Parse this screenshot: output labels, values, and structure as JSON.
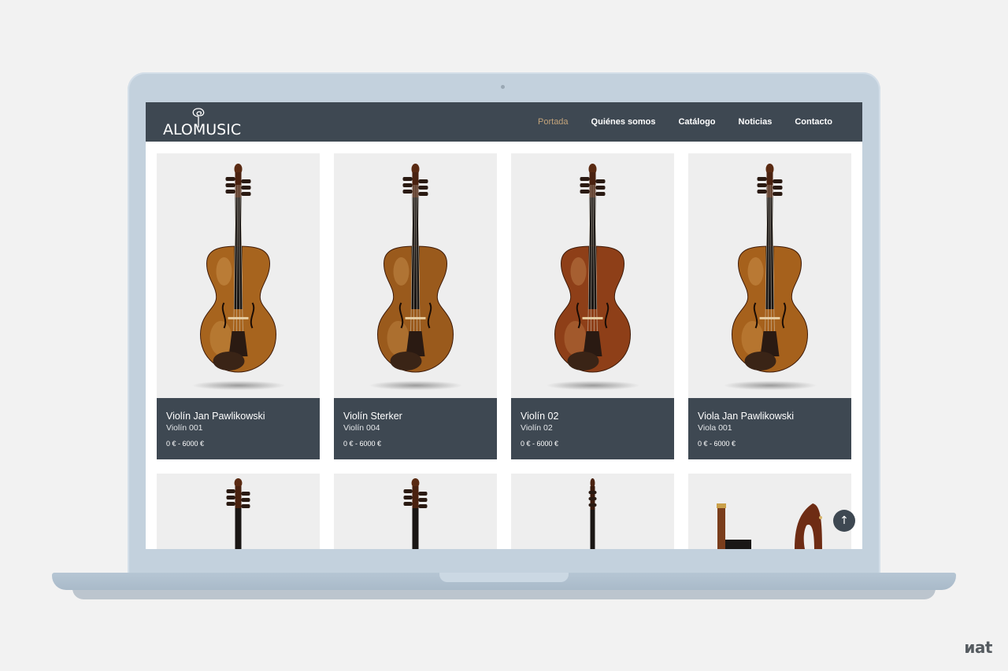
{
  "site": {
    "logo_text": "ALOMUSIC",
    "nav": [
      {
        "label": "Portada",
        "active": true
      },
      {
        "label": "Quiénes somos",
        "active": false
      },
      {
        "label": "Catálogo",
        "active": false
      },
      {
        "label": "Noticias",
        "active": false
      },
      {
        "label": "Contacto",
        "active": false
      }
    ]
  },
  "products": [
    {
      "title": "Violín Jan Pawlikowski",
      "subtitle": "Violín 001",
      "price": "0 € - 6000 €",
      "body_color": "#a7641e"
    },
    {
      "title": "Violín Sterker",
      "subtitle": "Violín 004",
      "price": "0 € - 6000 €",
      "body_color": "#9a5a1c"
    },
    {
      "title": "Violín 02",
      "subtitle": "Violín 02",
      "price": "0 € - 6000 €",
      "body_color": "#8e3f18"
    },
    {
      "title": "Viola Jan Pawlikowski",
      "subtitle": "Viola 001",
      "price": "0 € - 6000 €",
      "body_color": "#a6611c"
    }
  ],
  "back_to_top_icon": "arrow-up-icon",
  "watermark": "иat",
  "colors": {
    "header_bg": "#3e4852",
    "accent": "#c2a37a",
    "laptop": "#c3d1dd"
  }
}
